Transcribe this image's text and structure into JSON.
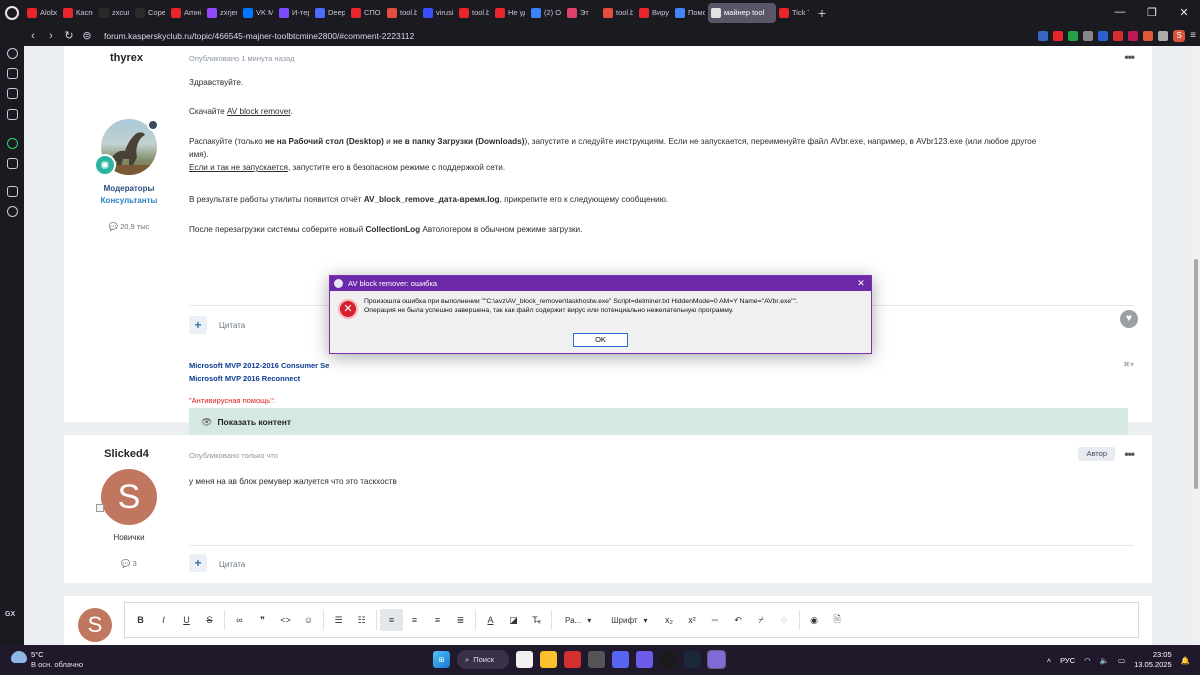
{
  "browser": {
    "tabs": [
      {
        "label": "Alobo",
        "color": "#e8252b"
      },
      {
        "label": "Каспе",
        "color": "#e8252b"
      },
      {
        "label": "zxcur",
        "color": "#2a2a2a"
      },
      {
        "label": "Copei",
        "color": "#2a2a2a"
      },
      {
        "label": "Amнi",
        "color": "#e8252b"
      },
      {
        "label": "zxrjer",
        "color": "#9147ff"
      },
      {
        "label": "VK Mo",
        "color": "#0077ff"
      },
      {
        "label": "И-тер",
        "color": "#7c4dff"
      },
      {
        "label": "DeepS",
        "color": "#4d6bfe"
      },
      {
        "label": "СПОС",
        "color": "#e8252b"
      },
      {
        "label": "tool.b",
        "color": "#e74c3c"
      },
      {
        "label": "virusi",
        "color": "#394eff"
      },
      {
        "label": "tool.b",
        "color": "#e8252b"
      },
      {
        "label": "Не уд",
        "color": "#e8252b"
      },
      {
        "label": "(2) От",
        "color": "#3b82f6"
      },
      {
        "label": "Эт",
        "color": "#e03e6b"
      },
      {
        "label": "tool.b",
        "color": "#e74c3c"
      },
      {
        "label": "Вирус",
        "color": "#e8252b"
      },
      {
        "label": "Помо",
        "color": "#4285f4"
      },
      {
        "label": "майнер tool",
        "color": "#e2e2e2",
        "active": true
      },
      {
        "label": "Tick T",
        "color": "#e8252b"
      }
    ],
    "url": "forum.kasperskyclub.ru/topic/466545-majner-toolbtcmine2800/#comment-2223112",
    "extensions": [
      "#3a66c4",
      "#e8252b",
      "#24a148",
      "#888888",
      "#2f5fd0",
      "#d32f2f",
      "#c2185b",
      "#e05a3a",
      "#aaaaaa"
    ],
    "profile_initial": "S",
    "add_tab": "+",
    "window_controls": [
      "—",
      "❐",
      "✕"
    ]
  },
  "sidebar": {
    "gx_label": "GX"
  },
  "post1": {
    "author": "thyrex",
    "meta": "Опубликовано 1 минута назад",
    "group": "Модераторы",
    "group_sub": "Консультанты",
    "posts_count": "💬 20,9 тыс",
    "greeting": "Здравствуйте.",
    "download_prefix": "Скачайте ",
    "download_link": "AV block remover",
    "download_suffix": ".",
    "unpack_1": "Распакуйте (только ",
    "unpack_b1": "не на Рабочий стол (Desktop)",
    "unpack_2": " и ",
    "unpack_b2": "не в папку Загрузки (Downloads)",
    "unpack_3": "), запустите и следуйте инструкциям. Если не запускается, переименуйте файл AVbr.exe, например, в AVbr123.exe (или любое другое",
    "unpack_4": "имя).",
    "safe_mode_link": "Если и так не запускается",
    "safe_mode_rest": ", запустите его в безопасном режиме с поддержкой сети.",
    "result_1": "В результате работы утилиты появится отчёт ",
    "result_b": "AV_block_remove_дата-время.log",
    "result_2": ", прикрепите его к следующему сообщению.",
    "reboot_1": "После перезагрузки системы соберите новый ",
    "reboot_b": "CollectionLog",
    "reboot_2": " Автологером в обычном режиме загрузки.",
    "quote": "Цитата",
    "sig_line1": "Microsoft MVP 2012-2016 Consumer Se",
    "sig_line2": "Microsoft MVP 2016 Reconnect",
    "av_help": "\"Антивирусная помощь\":",
    "spoiler": "Показать контент"
  },
  "post2": {
    "author": "Slicked4",
    "meta": "Опубликовано только что",
    "badge": "Автор",
    "avatar_letter": "S",
    "group": "Новички",
    "posts_count": "💬 3",
    "body": "у меня на ав блок ремувер жалуется что это таскхоств",
    "quote": "Цитата"
  },
  "editor": {
    "avatar_letter": "S",
    "paragraph_label": "Ра...",
    "font_label": "Шрифт"
  },
  "dialog": {
    "title": "AV block remover: ошибка",
    "message_1": "Произошла ошибка при выполнении \"\"C:\\avz\\AV_block_remover\\taskhostw.exe\" Script=delminer.txt HiddenMode=0 AM=Y Name=\"AVbr.exe\"\".",
    "message_2": "Операция не была успешно завершена, так как файл содержит вирус или потенциально нежелательную программу.",
    "ok": "OK"
  },
  "taskbar": {
    "temperature": "5°C",
    "weather": "В осн. облачно",
    "search": "Поиск",
    "apps": [
      "#f0f0f0",
      "#fbc02d",
      "#d32f2f",
      "#555555",
      "#5865f2",
      "#6c5ce7",
      "#1b1b1b",
      "#1b2838",
      "#7f6ad8"
    ],
    "language": "РУС",
    "time": "23:05",
    "date": "13.05.2025"
  }
}
